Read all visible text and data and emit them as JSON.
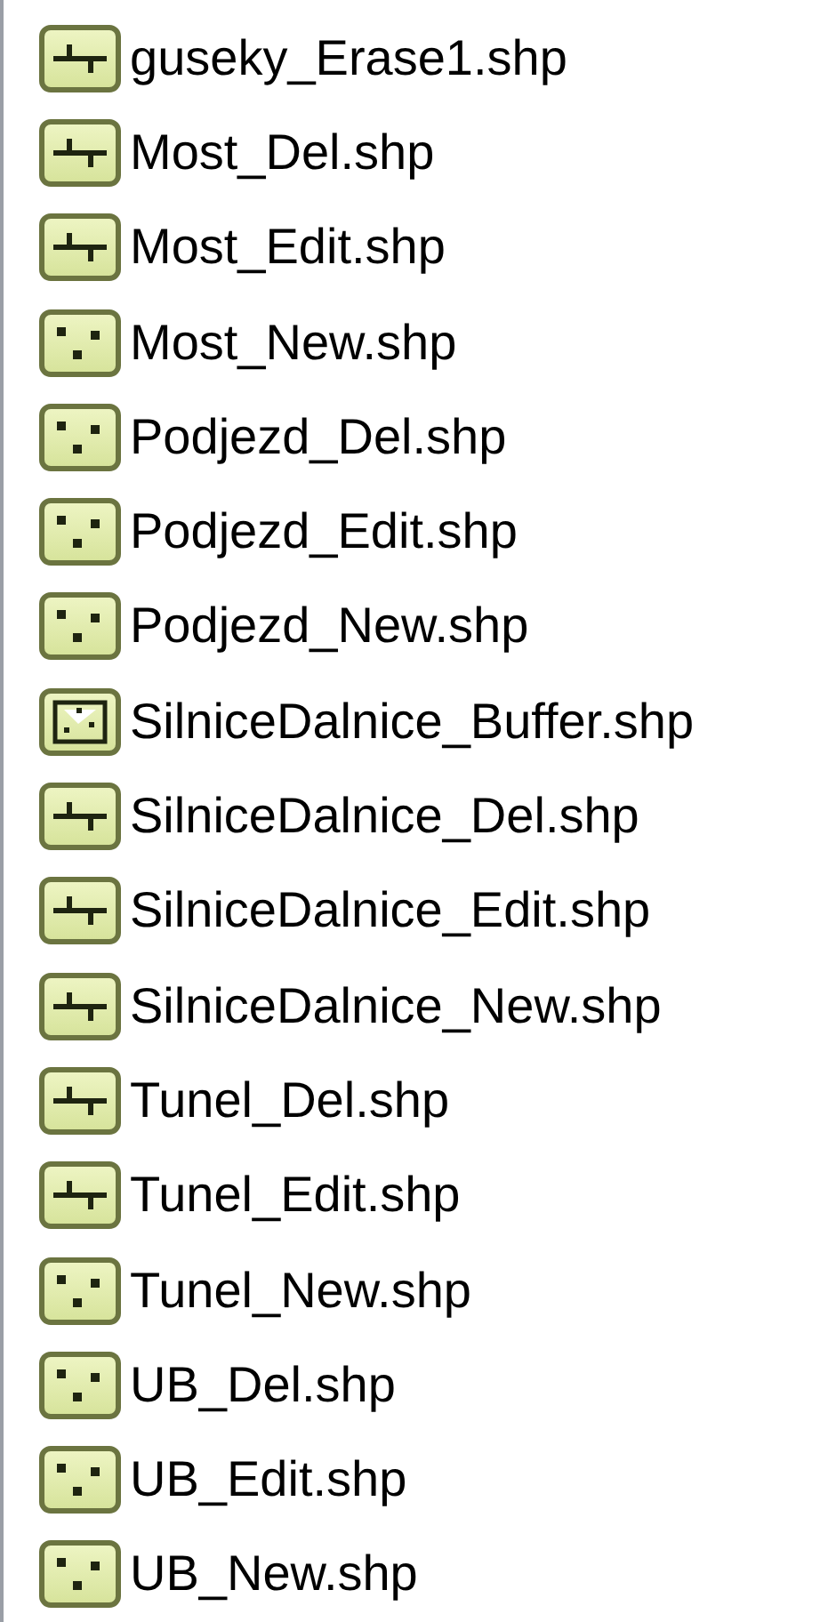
{
  "files": [
    {
      "name": "guseky_Erase1.shp",
      "kind": "line"
    },
    {
      "name": "Most_Del.shp",
      "kind": "line"
    },
    {
      "name": "Most_Edit.shp",
      "kind": "line"
    },
    {
      "name": "Most_New.shp",
      "kind": "point"
    },
    {
      "name": "Podjezd_Del.shp",
      "kind": "point"
    },
    {
      "name": "Podjezd_Edit.shp",
      "kind": "point"
    },
    {
      "name": "Podjezd_New.shp",
      "kind": "point"
    },
    {
      "name": "SilniceDalnice_Buffer.shp",
      "kind": "polygon"
    },
    {
      "name": "SilniceDalnice_Del.shp",
      "kind": "line"
    },
    {
      "name": "SilniceDalnice_Edit.shp",
      "kind": "line"
    },
    {
      "name": "SilniceDalnice_New.shp",
      "kind": "line"
    },
    {
      "name": "Tunel_Del.shp",
      "kind": "line"
    },
    {
      "name": "Tunel_Edit.shp",
      "kind": "line"
    },
    {
      "name": "Tunel_New.shp",
      "kind": "point"
    },
    {
      "name": "UB_Del.shp",
      "kind": "point"
    },
    {
      "name": "UB_Edit.shp",
      "kind": "point"
    },
    {
      "name": "UB_New.shp",
      "kind": "point"
    }
  ]
}
